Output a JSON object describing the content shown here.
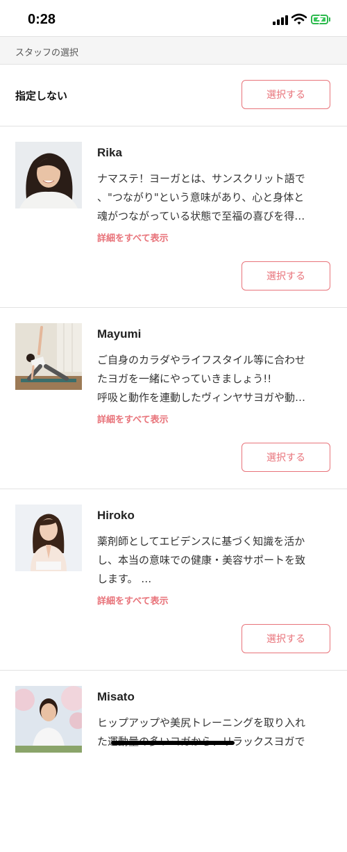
{
  "status_bar": {
    "time": "0:28"
  },
  "section_header": {
    "label": "スタッフの選択"
  },
  "no_preference": {
    "label": "指定しない",
    "button_label": "選択する"
  },
  "staff": [
    {
      "name": "Rika",
      "bio_lines": [
        "ナマステ！ヨーガとは、サンスクリット語で",
        "、\"つながり\"という意味があり、心と身体と",
        "魂がつながっている状態で至福の喜びを得…"
      ],
      "show_more": "詳細をすべて表示",
      "button_label": "選択する"
    },
    {
      "name": "Mayumi",
      "bio_lines": [
        "ご自身のカラダやライフスタイル等に合わせ",
        "たヨガを一緒にやっていきましょう!!",
        "呼吸と動作を連動したヴィンヤサヨガや動…"
      ],
      "show_more": "詳細をすべて表示",
      "button_label": "選択する"
    },
    {
      "name": "Hiroko",
      "bio_lines": [
        "薬剤師としてエビデンスに基づく知識を活か",
        "し、本当の意味での健康・美容サポートを致",
        "します。 …"
      ],
      "show_more": "詳細をすべて表示",
      "button_label": "選択する"
    },
    {
      "name": "Misato",
      "bio_lines": [
        "ヒップアップや美尻トレーニングを取り入れ",
        "た運動量の多いヨガから、リラックスヨガで"
      ],
      "show_more": "",
      "button_label": ""
    }
  ],
  "colors": {
    "accent": "#e8737a",
    "divider": "#e2e2e2",
    "header_bg": "#f5f5f5"
  }
}
